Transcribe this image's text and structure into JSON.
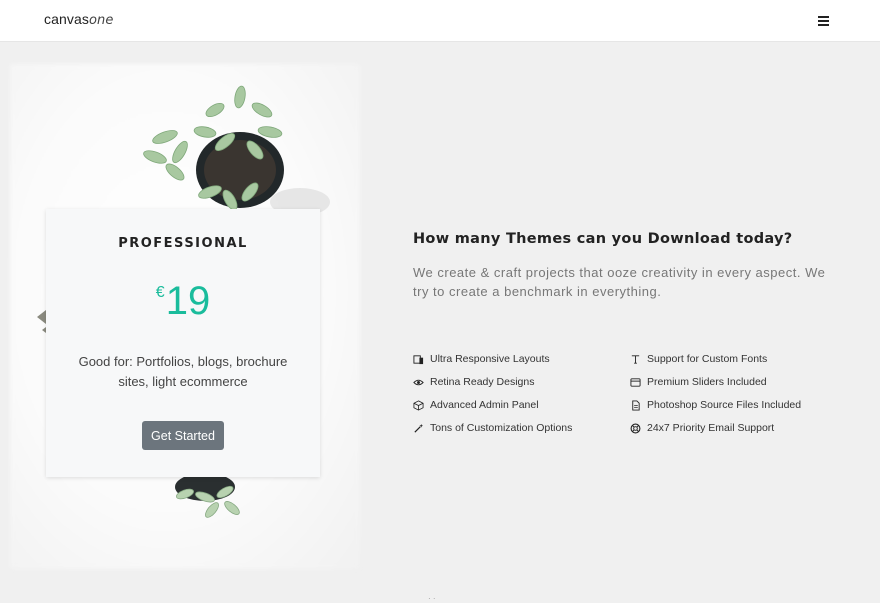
{
  "header": {
    "logo_main": "canvas",
    "logo_italic": "one",
    "menu_icon": "hamburger-icon"
  },
  "pricing_card": {
    "title": "PROFESSIONAL",
    "currency": "€",
    "price": "19",
    "description": "Good for: Portfolios, blogs, brochure sites, light ecommerce",
    "button_label": "Get Started"
  },
  "content": {
    "headline": "How many Themes can you Download today?",
    "subtext": "We create & craft projects that ooze creativity in every aspect. We try to create a benchmark in everything."
  },
  "features": [
    {
      "label": "Ultra Responsive Layouts",
      "icon": "devices-icon"
    },
    {
      "label": "Retina Ready Designs",
      "icon": "eye-icon"
    },
    {
      "label": "Advanced Admin Panel",
      "icon": "cube-icon"
    },
    {
      "label": "Tons of Customization Options",
      "icon": "magic-wand-icon"
    },
    {
      "label": "Support for Custom Fonts",
      "icon": "font-icon"
    },
    {
      "label": "Premium Sliders Included",
      "icon": "slider-icon"
    },
    {
      "label": "Photoshop Source Files Included",
      "icon": "file-icon"
    },
    {
      "label": "24x7 Priority Email Support",
      "icon": "support-icon"
    }
  ],
  "colors": {
    "accent": "#1abc9c",
    "button": "#6c757d",
    "page_bg": "#f0f0f0"
  }
}
